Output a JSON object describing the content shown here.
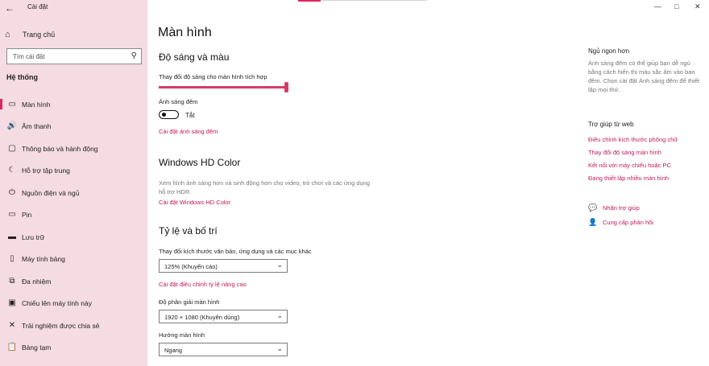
{
  "window": {
    "title": "Cài đặt",
    "back_icon": "←",
    "minimize_icon": "—",
    "maximize_icon": "□",
    "close_icon": "✕"
  },
  "sidebar": {
    "home_label": "Trang chủ",
    "home_icon": "⌂",
    "search_placeholder": "Tìm cài đặt",
    "search_icon": "⚲",
    "section_title": "Hệ thống",
    "items": [
      {
        "label": "Màn hình",
        "icon": "▭",
        "active": true
      },
      {
        "label": "Âm thanh",
        "icon": "🔊"
      },
      {
        "label": "Thông báo và hành động",
        "icon": "▢"
      },
      {
        "label": "Hỗ trợ tập trung",
        "icon": "☾"
      },
      {
        "label": "Nguồn điện và ngủ",
        "icon": "⏻"
      },
      {
        "label": "Pin",
        "icon": "▭"
      },
      {
        "label": "Lưu trữ",
        "icon": "▬"
      },
      {
        "label": "Máy tính bảng",
        "icon": "▯"
      },
      {
        "label": "Đa nhiệm",
        "icon": "⧉"
      },
      {
        "label": "Chiếu lên máy tính này",
        "icon": "▣"
      },
      {
        "label": "Trải nghiệm được chia sẻ",
        "icon": "✕"
      },
      {
        "label": "Bảng tạm",
        "icon": "📋"
      }
    ]
  },
  "main": {
    "page_title": "Màn hình",
    "brightness": {
      "heading": "Độ sáng và màu",
      "slider_label": "Thay đổi độ sáng cho màn hình tích hợp",
      "slider_value": 100,
      "night_light_label": "Ánh sáng đêm",
      "night_light_state": "Tắt",
      "night_light_on": false,
      "night_light_link": "Cài đặt ánh sáng đêm"
    },
    "hd_color": {
      "heading": "Windows HD Color",
      "description": "Xem hình ảnh sáng hơn và sinh động hơn cho video, trò chơi và các ứng dụng hỗ trợ HDR.",
      "link": "Cài đặt Windows HD Color"
    },
    "scale_layout": {
      "heading": "Tỷ lệ và bố trí",
      "scale_label": "Thay đổi kích thước văn bản, ứng dụng và các mục khác",
      "scale_value": "125% (Khuyến cáo)",
      "advanced_link": "Cài đặt điều chỉnh tỷ lệ nâng cao",
      "resolution_label": "Độ phân giải màn hình",
      "resolution_value": "1920 × 1080 (Khuyên dùng)",
      "orientation_label": "Hướng màn hình",
      "orientation_value": "Ngang",
      "chevron": "⌄"
    }
  },
  "right_column": {
    "sleep_heading": "Ngủ ngon hơn",
    "sleep_text": "Ánh sáng đêm có thể giúp bạn dễ ngủ bằng cách hiển thị màu sắc ấm vào ban đêm. Chọn cài đặt Ánh sáng đêm để thiết lập mọi thứ.",
    "help_heading": "Trợ giúp từ web",
    "help_links": [
      "Điều chỉnh kích thước phông chữ",
      "Thay đổi độ sáng màn hình",
      "Kết nối với máy chiếu hoặc PC",
      "Đang thiết lập nhiều màn hình"
    ],
    "get_help": "Nhận trợ giúp",
    "get_help_icon": "💬",
    "feedback": "Cung cấp phản hồi",
    "feedback_icon": "👤"
  },
  "colors": {
    "accent": "#e0245e",
    "link": "#c2185b",
    "sidebar_bg": "#f5dbe2"
  }
}
